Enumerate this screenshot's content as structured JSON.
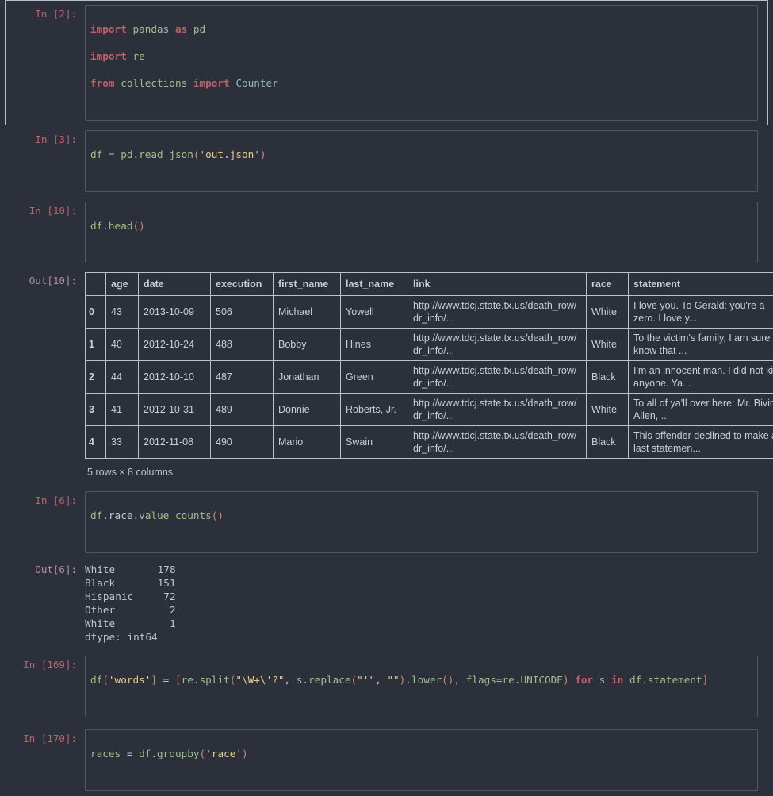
{
  "theme": {
    "background": "#2b303b",
    "in_prompt_color": "#bf616a",
    "out_prompt_color": "#b48ead",
    "text_color": "#c0c5ce",
    "selected_border": "#b9bec7",
    "cell_border": "#4f5666",
    "table_border": "#b9c0cc",
    "keyword_color": "#bf616a",
    "name_color": "#a3be8c",
    "string_color": "#ebcb8b",
    "punct_color": "#d08770"
  },
  "cells": [
    {
      "prompt": "In [2]:",
      "selected": true,
      "code_lines": [
        "import pandas as pd",
        "import re",
        "from collections import Counter"
      ],
      "tokens": {
        "l0": [
          "import",
          " pandas ",
          "as",
          " pd"
        ],
        "l1": [
          "import",
          " re"
        ],
        "l2": [
          "from",
          " collections ",
          "import",
          " Counter"
        ]
      }
    },
    {
      "prompt": "In [3]:",
      "selected": false,
      "code": "df = pd.read_json('out.json')",
      "parts": {
        "name": "df",
        "eq": " = ",
        "mod": "pd",
        "dot": ".",
        "call": "read_json",
        "open": "(",
        "arg": "'out.json'",
        "close": ")"
      }
    },
    {
      "prompt": "In [10]:",
      "selected": false,
      "code": "df.head()",
      "parts": {
        "name": "df",
        "dot": ".",
        "call": "head",
        "parens": "()"
      }
    }
  ],
  "dataframe_output": {
    "prompt": "Out[10]:",
    "columns": [
      "",
      "age",
      "date",
      "execution",
      "first_name",
      "last_name",
      "link",
      "race",
      "statement"
    ],
    "rows": [
      {
        "index": "0",
        "age": "43",
        "date": "2013-10-09",
        "execution": "506",
        "first_name": "Michael",
        "last_name": "Yowell",
        "link_line1": "http://www.tdcj.state.tx.us",
        "link_line2": "/death_row/dr_info/...",
        "race": "White",
        "statement": "I love you. To Gerald: you're a zero. I love y..."
      },
      {
        "index": "1",
        "age": "40",
        "date": "2012-10-24",
        "execution": "488",
        "first_name": "Bobby",
        "last_name": "Hines",
        "link_line1": "http://www.tdcj.state.tx.us",
        "link_line2": "/death_row/dr_info/...",
        "race": "White",
        "statement": "To the victim's family, I am sure I know that ..."
      },
      {
        "index": "2",
        "age": "44",
        "date": "2012-10-10",
        "execution": "487",
        "first_name": "Jonathan",
        "last_name": "Green",
        "link_line1": "http://www.tdcj.state.tx.us",
        "link_line2": "/death_row/dr_info/...",
        "race": "Black",
        "statement": "I'm an innocent man. I did not kill anyone. Ya..."
      },
      {
        "index": "3",
        "age": "41",
        "date": "2012-10-31",
        "execution": "489",
        "first_name": "Donnie",
        "last_name": "Roberts, Jr.",
        "link_line1": "http://www.tdcj.state.tx.us",
        "link_line2": "/death_row/dr_info/...",
        "race": "White",
        "statement": "To all of ya'll over here: Mr. Bivins, Allen, ..."
      },
      {
        "index": "4",
        "age": "33",
        "date": "2012-11-08",
        "execution": "490",
        "first_name": "Mario",
        "last_name": "Swain",
        "link_line1": "http://www.tdcj.state.tx.us",
        "link_line2": "/death_row/dr_info/...",
        "race": "Black",
        "statement": "This offender declined to make a last statemen..."
      }
    ],
    "shape_text": "5 rows × 8 columns"
  },
  "value_counts_cell": {
    "prompt": "In [6]:",
    "code": "df.race.value_counts()",
    "parts": {
      "name": "df",
      "attr1": ".race",
      "dot": ".",
      "call": "value_counts",
      "parens": "()"
    }
  },
  "value_counts_output": {
    "prompt": "Out[6]:",
    "lines": [
      "White       178",
      "Black       151",
      "Hispanic     72",
      "Other         2",
      "White         1",
      "dtype: int64"
    ],
    "entries": [
      {
        "label": "White",
        "count": "178"
      },
      {
        "label": "Black",
        "count": "151"
      },
      {
        "label": "Hispanic",
        "count": "72"
      },
      {
        "label": "Other",
        "count": "2"
      },
      {
        "label": "White",
        "count": "1"
      }
    ],
    "dtype": "dtype: int64"
  },
  "words_cell": {
    "prompt": "In [169]:",
    "code": "df['words'] = [re.split(\"\\W+\\'?\", s.replace(\"'\", \"\").lower(), flags=re.UNICODE) for s in df.statement]",
    "parts": {
      "df": "df",
      "bracket_open": "[",
      "key": "'words'",
      "bracket_close": "]",
      "eq": " = ",
      "list_open": "[",
      "re": "re",
      "dot1": ".",
      "split": "split",
      "paren_open": "(",
      "pattern": "\"\\W+\\'?\"",
      "comma1": ", ",
      "s": "s",
      "dot2": ".",
      "replace": "replace",
      "paren_open2": "(",
      "quote_arg": "\"'\"",
      "comma2": ", ",
      "empty_arg": "\"\"",
      "paren_close2": ")",
      "dot3": ".",
      "lower": "lower",
      "parens3": "(), ",
      "flags": "flags=",
      "re2": "re",
      "dot4": ".",
      "unicode": "UNICODE",
      "paren_close": ") ",
      "for_kw": "for",
      "var_s": " s ",
      "in_kw": "in",
      "df2": " df",
      "dot5": ".",
      "statement": "statement",
      "list_close": "]"
    }
  },
  "groupby_cell": {
    "prompt": "In [170]:",
    "code": "races = df.groupby('race')",
    "parts": {
      "races": "races",
      "eq": " = ",
      "df": "df",
      "dot": ".",
      "call": "groupby",
      "paren_open": "(",
      "arg": "'race'",
      "paren_close": ")"
    }
  }
}
